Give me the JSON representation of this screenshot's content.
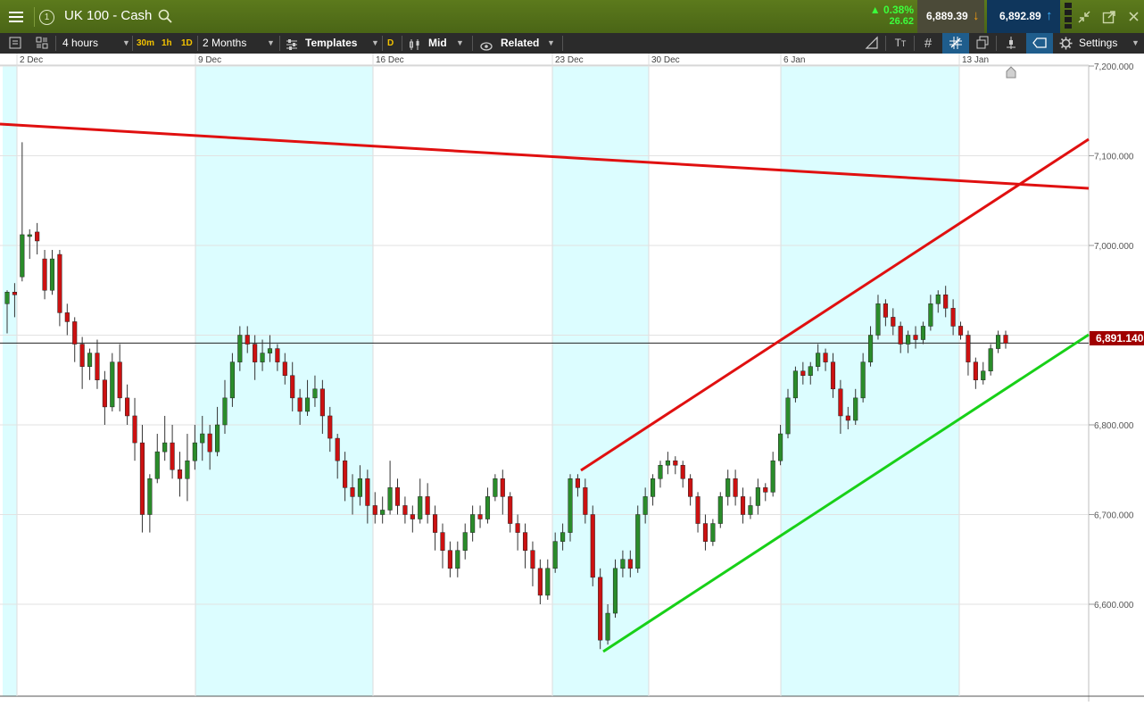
{
  "header": {
    "instrument": "UK 100 - Cash",
    "change_pct": "0.38%",
    "change_pts": "26.62",
    "sell_price": "6,889.39",
    "buy_price": "6,892.89",
    "sell_color": "#4a4a3a",
    "buy_color": "#10365a",
    "change_color": "#33ff33",
    "icons": [
      "menu-icon",
      "circle-one-icon",
      "search-icon",
      "minimize-icon",
      "popout-icon",
      "close-icon"
    ]
  },
  "toolbar": {
    "interval": "4 hours",
    "quick_30m": "30m",
    "quick_1h": "1h",
    "quick_1d": "1D",
    "range": "2 Months",
    "templates": "Templates",
    "d_badge": "D",
    "price_type": "Mid",
    "related": "Related",
    "settings": "Settings",
    "icons": [
      "list-icon",
      "layout-icon",
      "templates-icon",
      "candle-type-icon",
      "eye-icon",
      "draw-line-icon",
      "text-tool-icon",
      "grid-icon",
      "crosshair-icon",
      "layers-icon",
      "indicator-icon",
      "shape-icon",
      "gear-icon"
    ]
  },
  "current_price_label": "6,891.140",
  "current_price_color": "#a00000",
  "chart_data": {
    "type": "candlestick",
    "y_axis_ticks": [
      "7,200.000",
      "7,100.000",
      "7,000.000",
      "6,900.000",
      "6,800.000",
      "6,700.000",
      "6,600.000"
    ],
    "date_ticks": [
      "2 Dec",
      "9 Dec",
      "16 Dec",
      "23 Dec",
      "30 Dec",
      "6 Jan",
      "13 Jan"
    ],
    "ylim": [
      6480,
      7210
    ],
    "current_price": 6891.14,
    "up_color": "#2a8c2a",
    "down_color": "#cc1111",
    "weekend_shade": "#dcfdff",
    "trendlines": [
      {
        "color": "#e01010",
        "role": "long-term resistance"
      },
      {
        "color": "#e01010",
        "role": "channel top"
      },
      {
        "color": "#18d018",
        "role": "channel bottom"
      }
    ],
    "candles": [
      [
        6935,
        6948,
        6902,
        6950
      ],
      [
        6948,
        6945,
        6920,
        6958
      ],
      [
        6965,
        7012,
        6960,
        7115
      ],
      [
        7010,
        7012,
        6985,
        7018
      ],
      [
        7015,
        7005,
        6990,
        7025
      ],
      [
        6985,
        6950,
        6940,
        6995
      ],
      [
        6950,
        6985,
        6945,
        6995
      ],
      [
        6990,
        6925,
        6910,
        6995
      ],
      [
        6925,
        6915,
        6900,
        6935
      ],
      [
        6915,
        6890,
        6870,
        6920
      ],
      [
        6890,
        6865,
        6840,
        6898
      ],
      [
        6865,
        6880,
        6850,
        6885
      ],
      [
        6880,
        6850,
        6840,
        6895
      ],
      [
        6850,
        6820,
        6800,
        6860
      ],
      [
        6820,
        6870,
        6815,
        6880
      ],
      [
        6870,
        6830,
        6815,
        6890
      ],
      [
        6830,
        6810,
        6800,
        6845
      ],
      [
        6810,
        6780,
        6760,
        6830
      ],
      [
        6780,
        6700,
        6680,
        6800
      ],
      [
        6700,
        6740,
        6680,
        6745
      ],
      [
        6740,
        6770,
        6735,
        6790
      ],
      [
        6770,
        6780,
        6760,
        6810
      ],
      [
        6780,
        6750,
        6740,
        6800
      ],
      [
        6750,
        6740,
        6720,
        6770
      ],
      [
        6740,
        6760,
        6715,
        6790
      ],
      [
        6760,
        6780,
        6750,
        6800
      ],
      [
        6780,
        6790,
        6760,
        6810
      ],
      [
        6790,
        6770,
        6750,
        6800
      ],
      [
        6770,
        6800,
        6765,
        6820
      ],
      [
        6800,
        6830,
        6790,
        6850
      ],
      [
        6830,
        6870,
        6820,
        6880
      ],
      [
        6870,
        6900,
        6860,
        6910
      ],
      [
        6900,
        6890,
        6880,
        6910
      ],
      [
        6890,
        6870,
        6850,
        6900
      ],
      [
        6870,
        6880,
        6860,
        6895
      ],
      [
        6880,
        6885,
        6870,
        6900
      ],
      [
        6885,
        6870,
        6860,
        6890
      ],
      [
        6870,
        6855,
        6845,
        6880
      ],
      [
        6855,
        6830,
        6815,
        6870
      ],
      [
        6830,
        6815,
        6800,
        6840
      ],
      [
        6815,
        6830,
        6810,
        6850
      ],
      [
        6830,
        6840,
        6820,
        6855
      ],
      [
        6840,
        6810,
        6790,
        6850
      ],
      [
        6810,
        6785,
        6770,
        6820
      ],
      [
        6785,
        6760,
        6740,
        6790
      ],
      [
        6760,
        6730,
        6715,
        6770
      ],
      [
        6730,
        6720,
        6700,
        6745
      ],
      [
        6720,
        6740,
        6710,
        6755
      ],
      [
        6740,
        6710,
        6690,
        6750
      ],
      [
        6710,
        6700,
        6690,
        6725
      ],
      [
        6700,
        6705,
        6690,
        6720
      ],
      [
        6705,
        6730,
        6700,
        6760
      ],
      [
        6730,
        6710,
        6700,
        6740
      ],
      [
        6710,
        6700,
        6690,
        6720
      ],
      [
        6700,
        6695,
        6680,
        6710
      ],
      [
        6695,
        6720,
        6690,
        6740
      ],
      [
        6720,
        6700,
        6690,
        6735
      ],
      [
        6700,
        6680,
        6660,
        6710
      ],
      [
        6680,
        6660,
        6640,
        6690
      ],
      [
        6660,
        6640,
        6630,
        6670
      ],
      [
        6640,
        6660,
        6630,
        6670
      ],
      [
        6660,
        6680,
        6650,
        6690
      ],
      [
        6680,
        6700,
        6670,
        6710
      ],
      [
        6700,
        6695,
        6685,
        6710
      ],
      [
        6695,
        6720,
        6690,
        6730
      ],
      [
        6720,
        6740,
        6715,
        6745
      ],
      [
        6740,
        6720,
        6700,
        6750
      ],
      [
        6720,
        6690,
        6680,
        6725
      ],
      [
        6690,
        6680,
        6660,
        6700
      ],
      [
        6680,
        6660,
        6640,
        6690
      ],
      [
        6660,
        6640,
        6620,
        6670
      ],
      [
        6640,
        6610,
        6600,
        6650
      ],
      [
        6610,
        6640,
        6605,
        6650
      ],
      [
        6640,
        6670,
        6635,
        6680
      ],
      [
        6670,
        6680,
        6660,
        6690
      ],
      [
        6680,
        6740,
        6670,
        6745
      ],
      [
        6740,
        6730,
        6720,
        6745
      ],
      [
        6730,
        6700,
        6690,
        6740
      ],
      [
        6700,
        6630,
        6620,
        6710
      ],
      [
        6630,
        6560,
        6550,
        6640
      ],
      [
        6560,
        6590,
        6555,
        6600
      ],
      [
        6590,
        6640,
        6585,
        6650
      ],
      [
        6640,
        6650,
        6630,
        6660
      ],
      [
        6650,
        6640,
        6630,
        6660
      ],
      [
        6640,
        6700,
        6635,
        6710
      ],
      [
        6700,
        6720,
        6690,
        6730
      ],
      [
        6720,
        6740,
        6710,
        6745
      ],
      [
        6740,
        6755,
        6730,
        6760
      ],
      [
        6755,
        6760,
        6745,
        6770
      ],
      [
        6760,
        6755,
        6745,
        6765
      ],
      [
        6755,
        6740,
        6730,
        6760
      ],
      [
        6740,
        6720,
        6710,
        6745
      ],
      [
        6720,
        6690,
        6680,
        6725
      ],
      [
        6690,
        6670,
        6660,
        6700
      ],
      [
        6670,
        6690,
        6665,
        6695
      ],
      [
        6690,
        6720,
        6685,
        6725
      ],
      [
        6720,
        6740,
        6710,
        6750
      ],
      [
        6740,
        6720,
        6710,
        6750
      ],
      [
        6720,
        6700,
        6690,
        6730
      ],
      [
        6700,
        6710,
        6695,
        6720
      ],
      [
        6710,
        6730,
        6700,
        6740
      ],
      [
        6730,
        6725,
        6715,
        6735
      ],
      [
        6725,
        6760,
        6720,
        6770
      ],
      [
        6760,
        6790,
        6755,
        6800
      ],
      [
        6790,
        6830,
        6785,
        6840
      ],
      [
        6830,
        6860,
        6825,
        6865
      ],
      [
        6860,
        6855,
        6845,
        6870
      ],
      [
        6855,
        6865,
        6845,
        6870
      ],
      [
        6865,
        6880,
        6860,
        6890
      ],
      [
        6880,
        6870,
        6860,
        6885
      ],
      [
        6870,
        6840,
        6830,
        6880
      ],
      [
        6840,
        6810,
        6790,
        6850
      ],
      [
        6810,
        6805,
        6795,
        6820
      ],
      [
        6805,
        6830,
        6800,
        6840
      ],
      [
        6830,
        6870,
        6825,
        6880
      ],
      [
        6870,
        6900,
        6865,
        6910
      ],
      [
        6900,
        6935,
        6895,
        6945
      ],
      [
        6935,
        6920,
        6910,
        6940
      ],
      [
        6920,
        6910,
        6900,
        6930
      ],
      [
        6910,
        6890,
        6880,
        6915
      ],
      [
        6890,
        6900,
        6880,
        6905
      ],
      [
        6900,
        6895,
        6885,
        6910
      ],
      [
        6895,
        6910,
        6890,
        6915
      ],
      [
        6910,
        6935,
        6905,
        6945
      ],
      [
        6935,
        6945,
        6925,
        6950
      ],
      [
        6945,
        6930,
        6920,
        6955
      ],
      [
        6930,
        6910,
        6900,
        6940
      ],
      [
        6910,
        6900,
        6895,
        6915
      ],
      [
        6900,
        6870,
        6855,
        6905
      ],
      [
        6870,
        6850,
        6840,
        6875
      ],
      [
        6850,
        6860,
        6845,
        6870
      ],
      [
        6860,
        6885,
        6855,
        6890
      ],
      [
        6885,
        6900,
        6880,
        6905
      ],
      [
        6900,
        6891,
        6885,
        6905
      ]
    ]
  }
}
